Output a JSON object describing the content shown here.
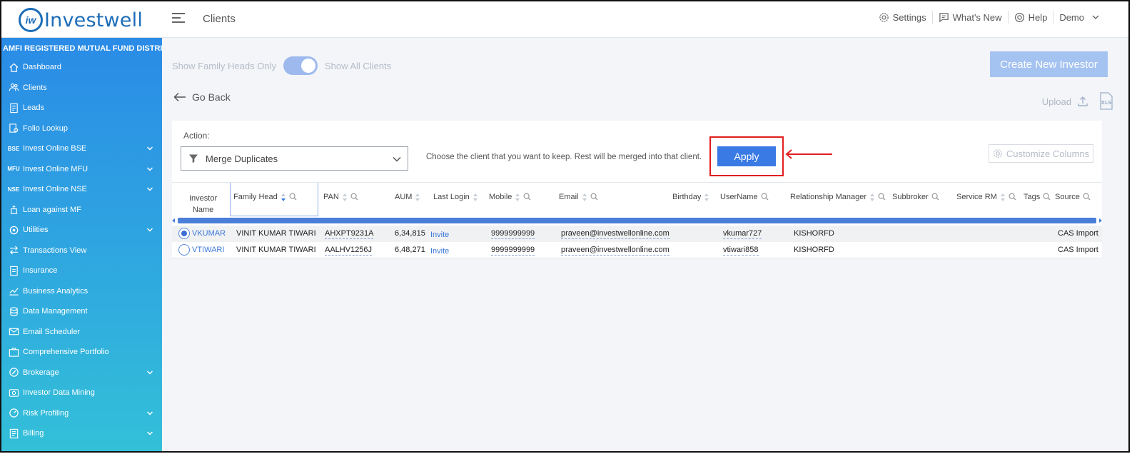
{
  "app": {
    "logo_mark": "iw",
    "logo_text": "Investwell",
    "page_title": "Clients"
  },
  "topnav": {
    "settings": "Settings",
    "whats_new": "What's New",
    "help": "Help",
    "user": "Demo"
  },
  "sidebar": {
    "header": "AMFI REGISTERED MUTUAL FUND DISTRIBUTOR",
    "items": [
      {
        "label": "Dashboard",
        "icon": "home-icon"
      },
      {
        "label": "Clients",
        "icon": "users-icon"
      },
      {
        "label": "Leads",
        "icon": "leads-icon"
      },
      {
        "label": "Folio Lookup",
        "icon": "folio-icon"
      },
      {
        "label": "Invest Online BSE",
        "icon": "bse-icon",
        "badge": "BSE",
        "expandable": true
      },
      {
        "label": "Invest Online MFU",
        "icon": "mfu-icon",
        "badge": "MFU",
        "expandable": true
      },
      {
        "label": "Invest Online NSE",
        "icon": "nse-icon",
        "badge": "NSE",
        "expandable": true
      },
      {
        "label": "Loan against MF",
        "icon": "loan-icon"
      },
      {
        "label": "Utilities",
        "icon": "utilities-icon",
        "expandable": true
      },
      {
        "label": "Transactions View",
        "icon": "transactions-icon"
      },
      {
        "label": "Insurance",
        "icon": "insurance-icon"
      },
      {
        "label": "Business Analytics",
        "icon": "analytics-icon"
      },
      {
        "label": "Data Management",
        "icon": "data-icon"
      },
      {
        "label": "Email Scheduler",
        "icon": "email-icon"
      },
      {
        "label": "Comprehensive Portfolio",
        "icon": "portfolio-icon"
      },
      {
        "label": "Brokerage",
        "icon": "brokerage-icon",
        "expandable": true
      },
      {
        "label": "Investor Data Mining",
        "icon": "mining-icon"
      },
      {
        "label": "Risk Profiling",
        "icon": "risk-icon",
        "expandable": true
      },
      {
        "label": "Billing",
        "icon": "billing-icon",
        "expandable": true
      }
    ]
  },
  "toolbar": {
    "family_heads_only": "Show Family Heads Only",
    "all_clients": "Show All Clients",
    "create_investor": "Create New Investor",
    "go_back": "Go Back",
    "upload": "Upload",
    "xls": "XLS"
  },
  "action": {
    "label": "Action:",
    "selected": "Merge Duplicates",
    "hint": "Choose the client that you want to keep. Rest will be merged into that client.",
    "apply": "Apply",
    "customize_columns": "Customize Columns"
  },
  "table": {
    "columns": [
      "Investor Name",
      "Family Head",
      "PAN",
      "AUM",
      "Last Login",
      "Mobile",
      "Email",
      "Birthday",
      "UserName",
      "Relationship Manager",
      "Subbroker",
      "Service RM",
      "Tags",
      "Source"
    ],
    "investor_name_line1": "Investor",
    "investor_name_line2": "Name",
    "rows": [
      {
        "selected": true,
        "investor": "VKUMAR",
        "family_head": "VINIT KUMAR TIWARI",
        "pan": "AHXPT9231A",
        "aum": "6,34,815",
        "last_login": "Invite",
        "mobile": "9999999999",
        "email": "praveen@investwellonline.com",
        "birthday": "",
        "username": "vkumar727",
        "rm": "KISHORFD",
        "subbroker": "",
        "service_rm": "",
        "tags": "",
        "source": "CAS Import"
      },
      {
        "selected": false,
        "investor": "VTIWARI",
        "family_head": "VINIT KUMAR TIWARI",
        "pan": "AALHV1256J",
        "aum": "6,48,271",
        "last_login": "Invite",
        "mobile": "9999999999",
        "email": "praveen@investwellonline.com",
        "birthday": "",
        "username": "vtiwari858",
        "rm": "KISHORFD",
        "subbroker": "",
        "service_rm": "",
        "tags": "",
        "source": "CAS Import"
      }
    ]
  },
  "colors": {
    "primary": "#3a7ae4",
    "sidebar_top": "#2a8be6",
    "sidebar_bottom": "#33c0d8",
    "annotation": "#e21d1d"
  }
}
